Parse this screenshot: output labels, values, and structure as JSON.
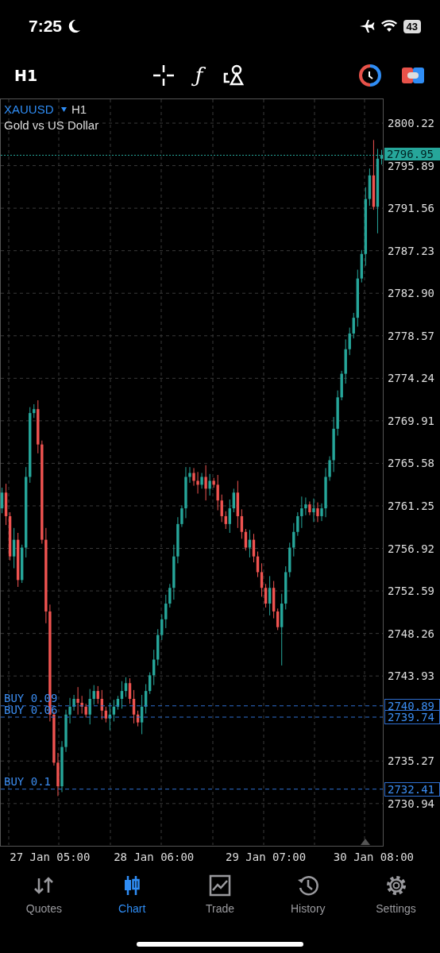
{
  "status_bar": {
    "time": "7:25",
    "battery": "43"
  },
  "toolbar": {
    "timeframe": "H1",
    "function_icon": "ƒ"
  },
  "chart": {
    "symbol": "XAUUSD",
    "symbol_timeframe": "H1",
    "description": "Gold vs US Dollar",
    "current_price": "2796.95",
    "orders": [
      {
        "label": "BUY 0.09",
        "price": "2740.89"
      },
      {
        "label": "BUY 0.06",
        "price": "2739.74"
      },
      {
        "label": "BUY 0.1",
        "price": "2732.41"
      }
    ],
    "chart_data": {
      "type": "candlestick",
      "categories": [
        null,
        null,
        null,
        null,
        null,
        null,
        null,
        null,
        null,
        null,
        null,
        null,
        "27 Jan 05:00",
        null,
        null,
        null,
        null,
        null,
        null,
        null,
        null,
        null,
        null,
        null,
        null,
        null,
        null,
        null,
        null,
        null,
        null,
        null,
        null,
        null,
        null,
        null,
        null,
        null,
        "28 Jan 06:00",
        null,
        null,
        null,
        null,
        null,
        null,
        null,
        null,
        null,
        null,
        null,
        null,
        null,
        null,
        null,
        null,
        null,
        null,
        null,
        null,
        null,
        null,
        null,
        null,
        null,
        null,
        null,
        "29 Jan 07:00",
        null,
        null,
        null,
        null,
        null,
        null,
        null,
        null,
        null,
        null,
        null,
        null,
        null,
        null,
        null,
        null,
        null,
        null,
        null,
        null,
        null,
        null,
        null,
        null,
        null,
        null,
        "30 Jan 08:00",
        null,
        null
      ],
      "ylim": [
        2726.64,
        2802.73
      ],
      "grid": true,
      "ref_lines": [
        {
          "axis": "y",
          "value": 2796.95,
          "color": "#26a69a"
        },
        {
          "axis": "y",
          "value": 2740.89,
          "color": "#2f6fd0"
        },
        {
          "axis": "y",
          "value": 2739.74,
          "color": "#2f6fd0"
        },
        {
          "axis": "y",
          "value": 2732.41,
          "color": "#2f6fd0"
        }
      ],
      "ohlc": [
        [
          2761.0,
          2763.1,
          2760.5,
          2762.6
        ],
        [
          2762.6,
          2763.5,
          2759.3,
          2760.2
        ],
        [
          2760.2,
          2760.6,
          2755.7,
          2756.1
        ],
        [
          2756.1,
          2759.0,
          2754.9,
          2757.8
        ],
        [
          2757.8,
          2758.5,
          2753.0,
          2753.7
        ],
        [
          2753.7,
          2757.3,
          2753.4,
          2757.0
        ],
        [
          2757.0,
          2765.2,
          2756.0,
          2764.2
        ],
        [
          2764.2,
          2771.3,
          2763.6,
          2770.7
        ],
        [
          2770.7,
          2771.6,
          2770.2,
          2771.1
        ],
        [
          2771.1,
          2772.0,
          2766.6,
          2767.5
        ],
        [
          2767.5,
          2767.9,
          2757.4,
          2757.8
        ],
        [
          2757.8,
          2759.0,
          2749.3,
          2750.5
        ],
        [
          2750.5,
          2751.2,
          2739.3,
          2740.0
        ],
        [
          2740.0,
          2740.3,
          2734.8,
          2735.1
        ],
        [
          2735.1,
          2736.1,
          2731.7,
          2732.7
        ],
        [
          2732.7,
          2737.3,
          2732.1,
          2736.7
        ],
        [
          2736.7,
          2740.5,
          2736.2,
          2740.0
        ],
        [
          2740.0,
          2741.7,
          2739.1,
          2740.8
        ],
        [
          2740.8,
          2742.0,
          2740.4,
          2741.6
        ],
        [
          2741.6,
          2742.8,
          2740.0,
          2741.2
        ],
        [
          2741.2,
          2741.9,
          2740.1,
          2740.8
        ],
        [
          2740.8,
          2741.1,
          2739.7,
          2740.0
        ],
        [
          2740.0,
          2742.6,
          2739.0,
          2741.6
        ],
        [
          2741.6,
          2743.0,
          2741.0,
          2742.4
        ],
        [
          2742.4,
          2742.9,
          2741.1,
          2741.6
        ],
        [
          2741.6,
          2742.5,
          2739.5,
          2740.4
        ],
        [
          2740.4,
          2740.8,
          2739.2,
          2739.6
        ],
        [
          2739.6,
          2741.2,
          2738.4,
          2740.0
        ],
        [
          2740.0,
          2741.5,
          2739.3,
          2740.8
        ],
        [
          2740.8,
          2741.9,
          2740.5,
          2741.6
        ],
        [
          2741.6,
          2743.4,
          2740.6,
          2742.4
        ],
        [
          2742.4,
          2743.8,
          2741.8,
          2743.2
        ],
        [
          2743.2,
          2743.7,
          2741.1,
          2741.6
        ],
        [
          2741.6,
          2742.5,
          2739.1,
          2740.0
        ],
        [
          2740.0,
          2740.4,
          2738.8,
          2739.2
        ],
        [
          2739.2,
          2742.0,
          2738.0,
          2740.8
        ],
        [
          2740.8,
          2743.1,
          2740.1,
          2742.4
        ],
        [
          2742.4,
          2744.3,
          2742.1,
          2744.0
        ],
        [
          2744.0,
          2746.6,
          2743.0,
          2745.6
        ],
        [
          2745.6,
          2748.7,
          2745.0,
          2748.1
        ],
        [
          2748.1,
          2750.2,
          2747.6,
          2749.7
        ],
        [
          2749.7,
          2752.2,
          2748.8,
          2751.3
        ],
        [
          2751.3,
          2753.3,
          2750.9,
          2752.9
        ],
        [
          2752.9,
          2757.3,
          2751.7,
          2756.1
        ],
        [
          2756.1,
          2760.1,
          2755.4,
          2759.4
        ],
        [
          2759.4,
          2761.3,
          2759.1,
          2761.0
        ],
        [
          2761.0,
          2765.2,
          2760.0,
          2764.2
        ],
        [
          2764.2,
          2765.2,
          2763.6,
          2764.6
        ],
        [
          2764.6,
          2765.1,
          2763.3,
          2763.8
        ],
        [
          2763.8,
          2764.7,
          2762.5,
          2763.4
        ],
        [
          2763.4,
          2764.6,
          2763.0,
          2764.2
        ],
        [
          2764.2,
          2765.4,
          2761.8,
          2763.0
        ],
        [
          2763.0,
          2764.5,
          2762.3,
          2763.8
        ],
        [
          2763.8,
          2764.1,
          2763.1,
          2763.4
        ],
        [
          2763.4,
          2764.4,
          2760.8,
          2761.8
        ],
        [
          2761.8,
          2762.4,
          2759.6,
          2760.2
        ],
        [
          2760.2,
          2760.7,
          2758.9,
          2759.4
        ],
        [
          2759.4,
          2761.9,
          2758.5,
          2761.0
        ],
        [
          2761.0,
          2763.0,
          2760.6,
          2762.6
        ],
        [
          2762.6,
          2763.8,
          2759.0,
          2760.2
        ],
        [
          2760.2,
          2760.9,
          2757.9,
          2758.6
        ],
        [
          2758.6,
          2758.9,
          2756.7,
          2757.0
        ],
        [
          2757.0,
          2758.8,
          2756.0,
          2757.8
        ],
        [
          2757.8,
          2758.4,
          2755.5,
          2756.1
        ],
        [
          2756.1,
          2756.6,
          2754.0,
          2754.5
        ],
        [
          2754.5,
          2755.4,
          2752.0,
          2752.9
        ],
        [
          2752.9,
          2753.3,
          2750.9,
          2751.3
        ],
        [
          2751.3,
          2754.1,
          2750.1,
          2752.9
        ],
        [
          2752.9,
          2753.6,
          2749.8,
          2750.5
        ],
        [
          2750.5,
          2750.8,
          2748.6,
          2748.9
        ],
        [
          2748.9,
          2752.3,
          2745.0,
          2751.3
        ],
        [
          2751.3,
          2755.1,
          2750.7,
          2754.5
        ],
        [
          2754.5,
          2757.5,
          2754.0,
          2757.0
        ],
        [
          2757.0,
          2759.5,
          2756.1,
          2758.6
        ],
        [
          2758.6,
          2760.6,
          2758.2,
          2760.2
        ],
        [
          2760.2,
          2762.2,
          2759.0,
          2761.0
        ],
        [
          2761.0,
          2762.1,
          2760.3,
          2761.4
        ],
        [
          2761.4,
          2761.7,
          2760.3,
          2760.6
        ],
        [
          2760.6,
          2762.0,
          2759.6,
          2761.0
        ],
        [
          2761.0,
          2761.6,
          2759.6,
          2760.2
        ],
        [
          2760.2,
          2761.5,
          2759.7,
          2761.0
        ],
        [
          2761.0,
          2765.1,
          2760.1,
          2764.2
        ],
        [
          2764.2,
          2766.3,
          2763.8,
          2765.9
        ],
        [
          2765.9,
          2770.3,
          2764.7,
          2769.1
        ],
        [
          2769.1,
          2773.0,
          2768.4,
          2772.3
        ],
        [
          2772.3,
          2775.0,
          2772.0,
          2774.7
        ],
        [
          2774.7,
          2778.2,
          2773.7,
          2777.2
        ],
        [
          2777.2,
          2779.4,
          2776.6,
          2778.8
        ],
        [
          2778.8,
          2780.9,
          2778.3,
          2780.4
        ],
        [
          2780.4,
          2785.3,
          2779.5,
          2784.4
        ],
        [
          2784.4,
          2787.3,
          2784.0,
          2786.9
        ],
        [
          2786.9,
          2793.7,
          2785.7,
          2792.5
        ],
        [
          2792.5,
          2795.6,
          2791.8,
          2794.9
        ],
        [
          2794.9,
          2798.5,
          2791.4,
          2791.7
        ],
        [
          2791.7,
          2797.6,
          2789.0,
          2796.6
        ],
        [
          2796.6,
          2797.5,
          2796.0,
          2796.95
        ]
      ],
      "yticks": [
        {
          "value": 2800.22,
          "label": "2800.22"
        },
        {
          "value": 2795.89,
          "label": "2795.89"
        },
        {
          "value": 2791.56,
          "label": "2791.56"
        },
        {
          "value": 2787.23,
          "label": "2787.23"
        },
        {
          "value": 2782.9,
          "label": "2782.90"
        },
        {
          "value": 2778.57,
          "label": "2778.57"
        },
        {
          "value": 2774.24,
          "label": "2774.24"
        },
        {
          "value": 2769.91,
          "label": "2769.91"
        },
        {
          "value": 2765.58,
          "label": "2765.58"
        },
        {
          "value": 2761.25,
          "label": "2761.25"
        },
        {
          "value": 2756.92,
          "label": "2756.92"
        },
        {
          "value": 2752.59,
          "label": "2752.59"
        },
        {
          "value": 2748.26,
          "label": "2748.26"
        },
        {
          "value": 2743.93,
          "label": "2743.93"
        },
        {
          "value": 2735.27,
          "label": "2735.27"
        },
        {
          "value": 2730.94,
          "label": "2730.94"
        }
      ]
    }
  },
  "tabs": [
    {
      "label": "Quotes",
      "selected": false
    },
    {
      "label": "Chart",
      "selected": true
    },
    {
      "label": "Trade",
      "selected": false
    },
    {
      "label": "History",
      "selected": false
    },
    {
      "label": "Settings",
      "selected": false
    }
  ]
}
